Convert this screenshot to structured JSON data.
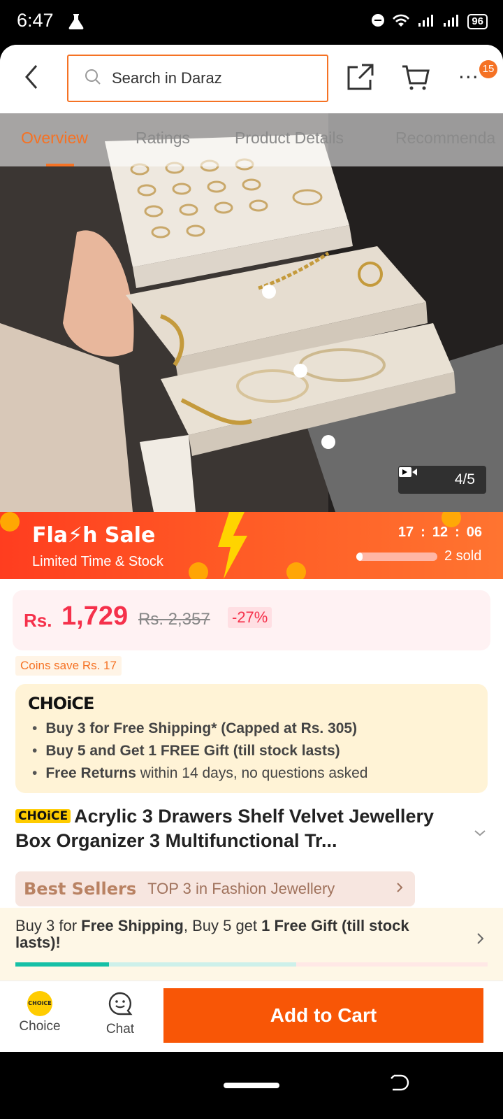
{
  "status": {
    "time": "6:47",
    "battery": "96"
  },
  "header": {
    "search_placeholder": "Search in Daraz",
    "cart_badge": "15"
  },
  "tabs": [
    "Overview",
    "Ratings",
    "Product Details",
    "Recommenda"
  ],
  "media": {
    "counter": "4/5"
  },
  "flash_sale": {
    "title": "Fla⚡h Sale",
    "subtitle": "Limited Time & Stock",
    "timer": [
      "17",
      ":",
      "12",
      ":",
      "06"
    ],
    "sold": "2 sold",
    "sold_progress": 0.08
  },
  "price": {
    "currency": "Rs.",
    "current": "1,729",
    "original": "Rs. 2,357",
    "discount": "-27%"
  },
  "coins": "Coins save Rs. 17",
  "choice": {
    "logo": "CHOiCE",
    "benefits": [
      {
        "bold": "Buy 3 for  Free Shipping* (Capped at Rs. 305)",
        "rest": ""
      },
      {
        "bold": "Buy 5 and Get 1 FREE Gift (till stock lasts)",
        "rest": ""
      },
      {
        "bold": "Free Returns",
        "rest": " within 14 days, no questions asked"
      }
    ]
  },
  "product": {
    "tag": "CHOiCE",
    "title": "Acrylic 3 Drawers Shelf Velvet Jewellery Box Organizer 3 Multifunctional Tr..."
  },
  "best_sellers": {
    "label": "Best Sellers",
    "text": "TOP 3 in Fashion Jewellery"
  },
  "promo": {
    "p1": "Buy 3 for ",
    "p2": "Free Shipping",
    "p3": ", Buy 5 get ",
    "p4": "1 Free Gift (till stock lasts)!"
  },
  "bottom": {
    "choice_label": "Choice",
    "choice_coin": "CHOiCE",
    "chat_label": "Chat",
    "add_to_cart": "Add to Cart"
  },
  "colors": {
    "accent": "#f57224",
    "price": "#f5314b",
    "cta": "#f85606",
    "choice_yellow": "#ffcc00"
  }
}
